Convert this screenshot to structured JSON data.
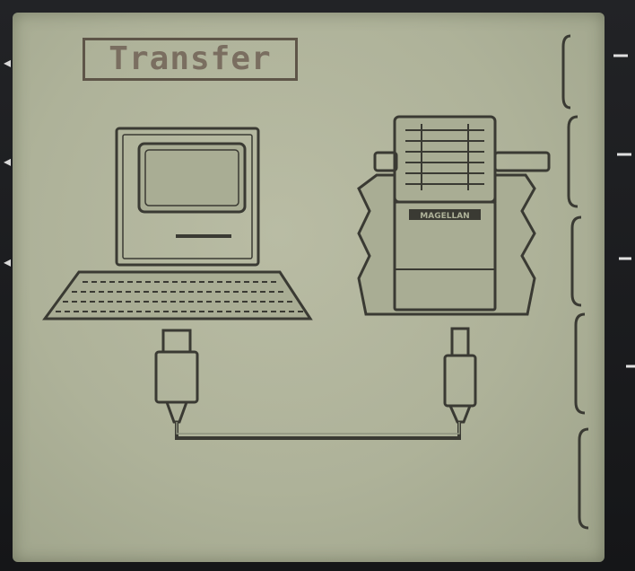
{
  "screen": {
    "title": "Transfer",
    "brand_label": "MAGELLAN"
  },
  "colors": {
    "lcd_background": "#aeb299",
    "lcd_ink": "#3a3a33",
    "title_text": "#7a6e60",
    "bezel": "#1c1d1f"
  },
  "icons": [
    "computer-icon",
    "gps-device-icon",
    "usb-cable-icon",
    "softkey-bracket-icon"
  ]
}
